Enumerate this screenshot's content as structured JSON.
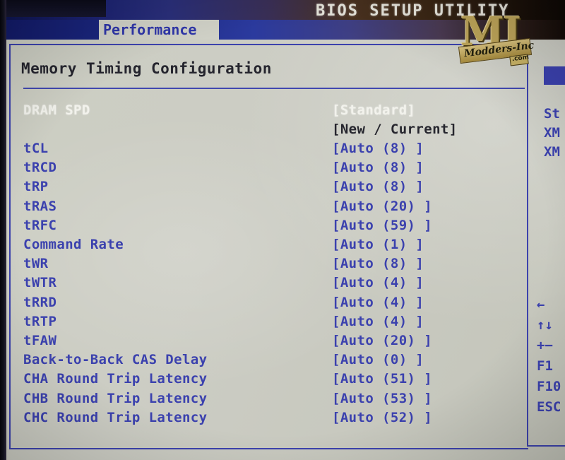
{
  "header": {
    "title": "BIOS SETUP UTILITY",
    "active_tab": "Performance"
  },
  "page": {
    "title": "Memory Timing Configuration",
    "column_header_label": "",
    "column_header_value": "[New / Current]"
  },
  "spd_row": {
    "label": "DRAM SPD",
    "value": "[Standard]"
  },
  "timings": [
    {
      "label": "tCL",
      "value": "[Auto  (8)   ]"
    },
    {
      "label": "tRCD",
      "value": "[Auto  (8)   ]"
    },
    {
      "label": "tRP",
      "value": "[Auto  (8)   ]"
    },
    {
      "label": "tRAS",
      "value": "[Auto  (20)  ]"
    },
    {
      "label": "tRFC",
      "value": "[Auto  (59)  ]"
    },
    {
      "label": "Command Rate",
      "value": "[Auto  (1)   ]"
    },
    {
      "label": "tWR",
      "value": "[Auto  (8)   ]"
    },
    {
      "label": "tWTR",
      "value": "[Auto  (4)   ]"
    },
    {
      "label": "tRRD",
      "value": "[Auto  (4)   ]"
    },
    {
      "label": "tRTP",
      "value": "[Auto  (4)   ]"
    },
    {
      "label": "tFAW",
      "value": "[Auto  (20)  ]"
    },
    {
      "label": "Back-to-Back CAS Delay",
      "value": "[Auto  (0)   ]"
    },
    {
      "label": "CHA Round Trip Latency",
      "value": "[Auto  (51)  ]"
    },
    {
      "label": "CHB Round Trip Latency",
      "value": "[Auto  (53)  ]"
    },
    {
      "label": "CHC Round Trip Latency",
      "value": "[Auto  (52)  ]"
    }
  ],
  "sidebar": {
    "options": [
      "St",
      "XM",
      "XM"
    ],
    "keys": [
      "←",
      "↑↓",
      "+−",
      "F1",
      "F10",
      "ESC"
    ]
  },
  "watermark": {
    "letter_m": "M",
    "letter_i": "I",
    "band": "Modders-Inc",
    "com": ".com"
  },
  "colors": {
    "screen_bg": "#c6c7bd",
    "text_blue": "#3b41ae",
    "text_white": "#f2f2ec",
    "text_dark": "#26262e",
    "title_bar_blue": "#1b2272",
    "logo_gold": "#bfa65a"
  }
}
